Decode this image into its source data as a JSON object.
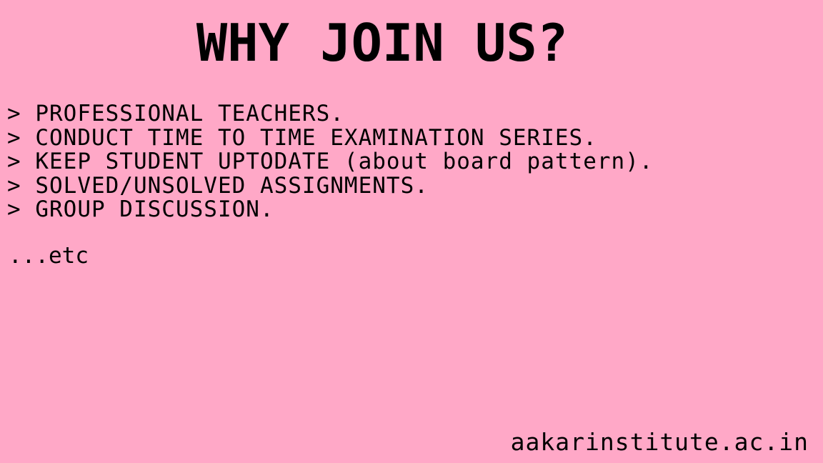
{
  "slide": {
    "background_color": "#ffa8c7",
    "text_color": "#000000",
    "title": "WHY JOIN US?",
    "points": [
      "> PROFESSIONAL TEACHERS.",
      "> CONDUCT TIME TO TIME EXAMINATION SERIES.",
      "> KEEP STUDENT UPTODATE (about board pattern).",
      "> SOLVED/UNSOLVED ASSIGNMENTS.",
      "> GROUP DISCUSSION."
    ],
    "etc": "...etc",
    "website": "aakarinstitute.ac.in"
  }
}
